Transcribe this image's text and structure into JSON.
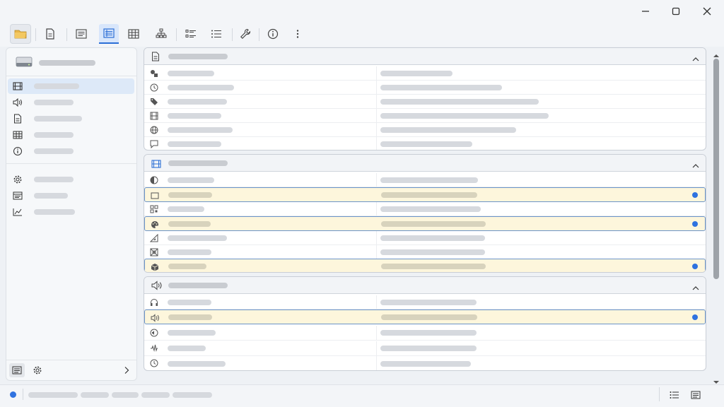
{
  "window": {
    "controls": [
      {
        "name": "minimize",
        "icon": "minimize-icon"
      },
      {
        "name": "maximize",
        "icon": "maximize-icon"
      },
      {
        "name": "close",
        "icon": "close-icon"
      }
    ]
  },
  "toolbar": {
    "buttons": [
      {
        "name": "open-folder",
        "icon": "folder-open-icon",
        "state": "normal"
      },
      {
        "name": "document-view",
        "icon": "document-icon",
        "state": "normal"
      },
      {
        "name": "text-view",
        "icon": "text-lines-icon",
        "state": "normal"
      },
      {
        "name": "list-view",
        "icon": "list-view-icon",
        "state": "active"
      },
      {
        "name": "grid-view",
        "icon": "grid-icon",
        "state": "normal"
      },
      {
        "name": "tree-view",
        "icon": "tree-icon",
        "state": "normal"
      },
      {
        "name": "bullet-list-view",
        "icon": "bullet-list-icon",
        "state": "normal"
      },
      {
        "name": "compact-list-view",
        "icon": "compact-list-icon",
        "state": "normal"
      },
      {
        "name": "tools",
        "icon": "wrench-icon",
        "state": "normal"
      },
      {
        "name": "info",
        "icon": "info-icon",
        "state": "normal"
      },
      {
        "name": "more",
        "icon": "more-vertical-icon",
        "state": "normal"
      }
    ]
  },
  "sidebar": {
    "header_icon": "drive-icon",
    "items": [
      {
        "icon": "film-icon",
        "selected": true
      },
      {
        "icon": "speaker-icon",
        "selected": false
      },
      {
        "icon": "document-icon",
        "selected": false
      },
      {
        "icon": "table-icon",
        "selected": false
      },
      {
        "icon": "info-icon",
        "selected": false
      },
      {
        "icon": "gear-icon",
        "selected": false
      },
      {
        "icon": "window-icon",
        "selected": false
      },
      {
        "icon": "chart-icon",
        "selected": false
      }
    ],
    "footer": [
      "details-icon",
      "gear-icon",
      "chevron-right-icon"
    ]
  },
  "groups": [
    {
      "icon": "document-icon",
      "accent": "#555555",
      "expanded": true,
      "rows": [
        {
          "icon": "shapes-icon",
          "highlighted": false
        },
        {
          "icon": "clock-icon",
          "highlighted": false
        },
        {
          "icon": "tag-icon",
          "highlighted": false
        },
        {
          "icon": "film-icon",
          "highlighted": false
        },
        {
          "icon": "globe-icon",
          "highlighted": false
        },
        {
          "icon": "comment-icon",
          "highlighted": false
        }
      ]
    },
    {
      "icon": "film-icon",
      "accent": "#2b6fd6",
      "expanded": true,
      "rows": [
        {
          "icon": "contrast-icon",
          "highlighted": false
        },
        {
          "icon": "screen-icon",
          "highlighted": true
        },
        {
          "icon": "qr-icon",
          "highlighted": false
        },
        {
          "icon": "palette-icon",
          "highlighted": true
        },
        {
          "icon": "ruler-icon",
          "highlighted": false
        },
        {
          "icon": "pattern-icon",
          "highlighted": false
        },
        {
          "icon": "cube-icon",
          "highlighted": true
        }
      ]
    },
    {
      "icon": "speaker-icon",
      "accent": "#555555",
      "expanded": true,
      "rows": [
        {
          "icon": "headphones-icon",
          "highlighted": false
        },
        {
          "icon": "speaker-icon",
          "highlighted": true
        },
        {
          "icon": "audio-globe-icon",
          "highlighted": false
        },
        {
          "icon": "waveform-icon",
          "highlighted": false
        },
        {
          "icon": "clock-icon",
          "highlighted": false
        }
      ]
    }
  ],
  "statusbar": {
    "indicator_color": "#2f72e0",
    "right_icons": [
      "list-icon",
      "details-icon"
    ]
  },
  "colors": {
    "accent": "#2f72e0",
    "highlight_row": "#fdf6dc",
    "selection": "#dde9f8"
  }
}
